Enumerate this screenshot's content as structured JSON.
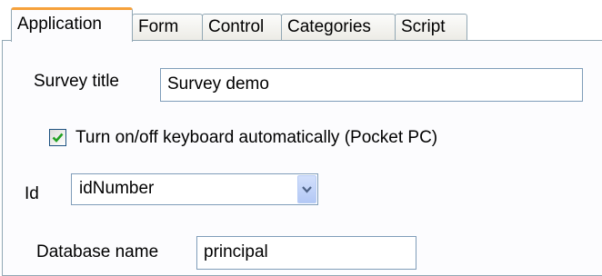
{
  "tabs": [
    {
      "label": "Application",
      "active": true
    },
    {
      "label": "Form",
      "active": false
    },
    {
      "label": "Control",
      "active": false
    },
    {
      "label": "Categories",
      "active": false
    },
    {
      "label": "Script",
      "active": false
    }
  ],
  "survey_title": {
    "label": "Survey title",
    "value": "Survey demo"
  },
  "keyboard_checkbox": {
    "label": "Turn on/off keyboard automatically (Pocket PC)",
    "checked": true
  },
  "id_field": {
    "label": "Id",
    "selected": "idNumber"
  },
  "database_name": {
    "label": "Database name",
    "value": "principal"
  },
  "colors": {
    "active_tab_accent": "#f6a13b",
    "border": "#7f9db9",
    "check": "#21a121"
  },
  "icons": {
    "dropdown": "chevron-down-icon",
    "check": "checkmark-icon"
  }
}
